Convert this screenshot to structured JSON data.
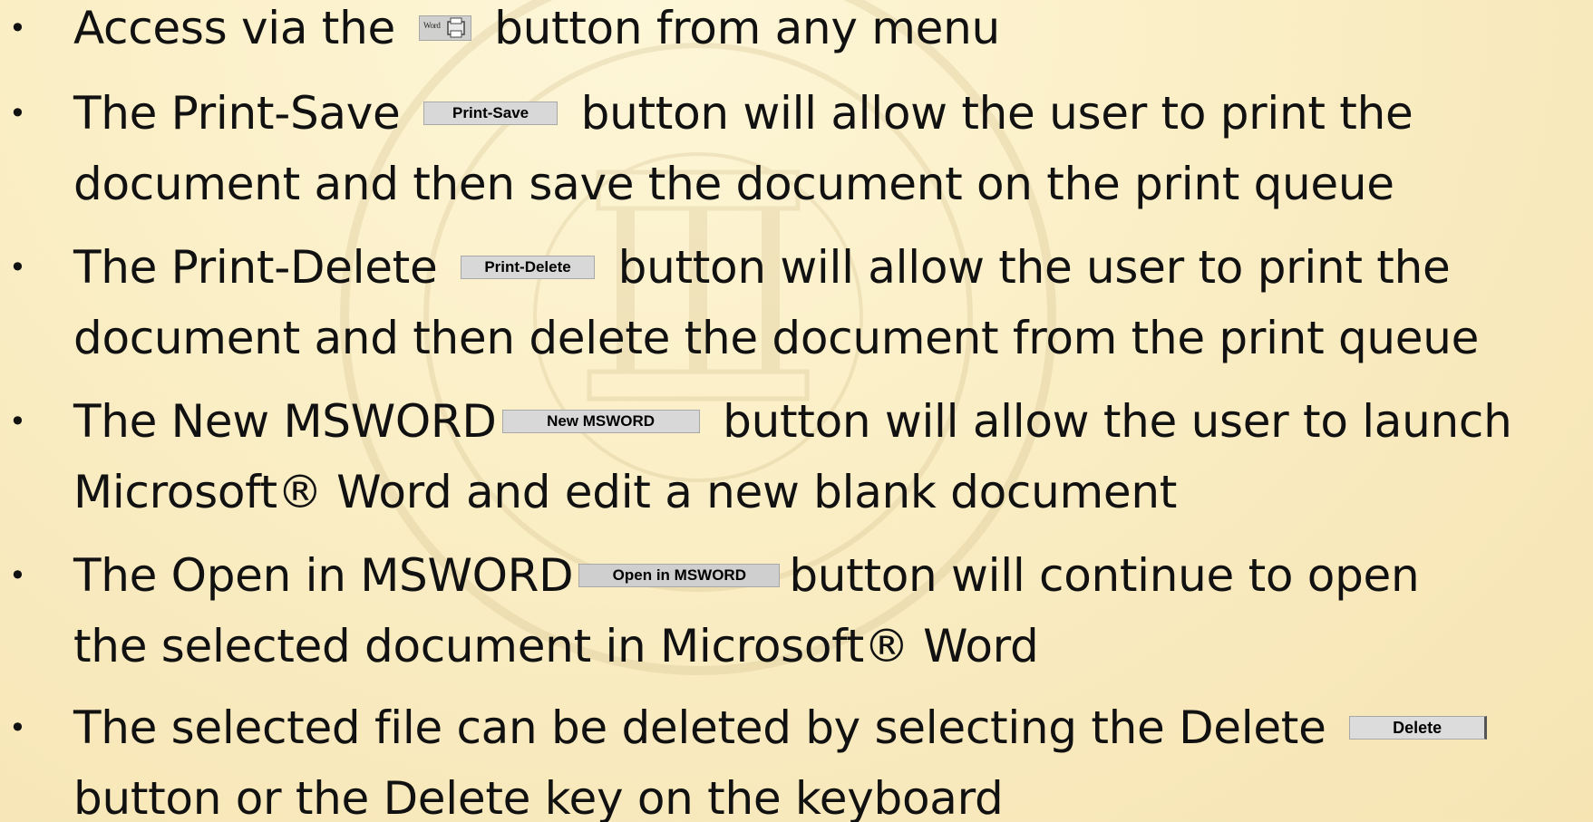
{
  "slide": {
    "bullets": [
      {
        "before": "Access via the",
        "button_icon": "word-printer-icon",
        "after": "button from any menu"
      },
      {
        "line1_before": "The Print-Save",
        "button": "Print-Save",
        "line1_after": "button will allow the user to print the",
        "line2": "document and then save the document on the print queue"
      },
      {
        "line1_before": "The Print-Delete",
        "button": "Print-Delete",
        "line1_after": "button will allow the user to print the",
        "line2": "document and then delete the document from the print queue"
      },
      {
        "line1_before": "The New MSWORD",
        "button": "New MSWORD",
        "line1_after": "button will allow the user to launch",
        "line2": "Microsoft® Word and edit a new blank document"
      },
      {
        "line1_before": "The Open in MSWORD",
        "button": "Open in MSWORD",
        "line1_after": "button will continue to open",
        "line2": "the selected document in Microsoft® Word"
      },
      {
        "line1_before": "The selected file can be deleted by selecting the Delete",
        "button": "Delete",
        "line2": "button or the Delete key on the keyboard"
      }
    ],
    "button_icon_text": "Word"
  }
}
